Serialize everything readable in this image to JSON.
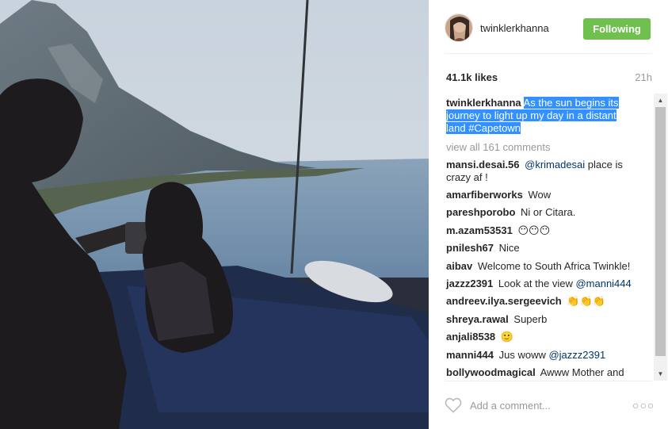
{
  "post": {
    "username": "twinklerkhanna",
    "follow_button": "Following",
    "likes": "41.1k likes",
    "time": "21h",
    "caption": {
      "username": "twinklerkhanna",
      "text": "As the sun begins its journey to light up my day in a distant land #Capetown"
    },
    "view_all": "view all 161 comments",
    "comments": [
      {
        "user": "mansi.desai.56",
        "mention": "@krimadesai",
        "text": " place is crazy af !"
      },
      {
        "user": "amarfiberworks",
        "mention": "",
        "text": "Wow"
      },
      {
        "user": "pareshporobo",
        "mention": "",
        "text": "Ni or Citara."
      },
      {
        "user": "m.azam53531",
        "mention": "",
        "text": "😶😶😶"
      },
      {
        "user": "pnilesh67",
        "mention": "",
        "text": "Nice"
      },
      {
        "user": "aibav",
        "mention": "",
        "text": "Welcome to South Africa Twinkle!"
      },
      {
        "user": "jazzz2391",
        "mention": "@manni444",
        "text": "Look at the view "
      },
      {
        "user": "andreev.ilya.sergeevich",
        "mention": "",
        "text": "👏👏👏"
      },
      {
        "user": "shreya.rawal",
        "mention": "",
        "text": "Superb"
      },
      {
        "user": "anjali8538",
        "mention": "",
        "text": "🙂"
      },
      {
        "user": "manni444",
        "mention": "@jazzz2391",
        "text": "Jus woww "
      },
      {
        "user": "bollywoodmagical",
        "mention": "",
        "text": "Awww Mother and"
      }
    ],
    "add_comment_placeholder": "Add a comment...",
    "more_label": "○○○"
  },
  "colors": {
    "follow_green": "#70c050",
    "mention_blue": "#003569",
    "selection_blue": "#3390ff",
    "muted_gray": "#999999"
  },
  "icons": [
    "heart-icon",
    "more-options-icon",
    "scroll-up-arrow-icon",
    "scroll-down-arrow-icon"
  ]
}
